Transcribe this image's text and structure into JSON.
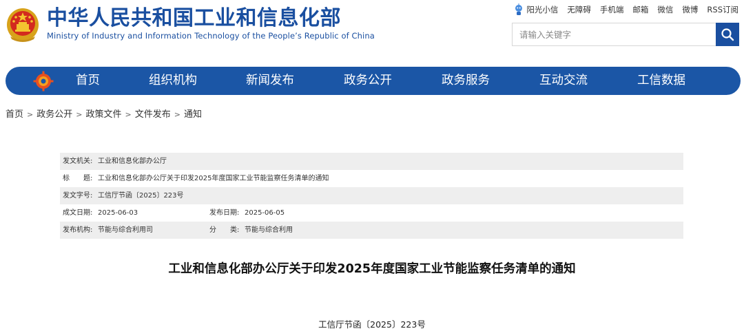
{
  "header": {
    "title": "中华人民共和国工业和信息化部",
    "subtitle": "Ministry of Industry and Information Technology of the People’s Republic of China",
    "links": [
      "阳光小信",
      "无障碍",
      "手机端",
      "邮箱",
      "微信",
      "微博",
      "RSS订阅"
    ],
    "search_placeholder": "请输入关键字",
    "brand_color": "#1a4fa0"
  },
  "nav": {
    "items": [
      "首页",
      "组织机构",
      "新闻发布",
      "政务公开",
      "政务服务",
      "互动交流",
      "工信数据"
    ],
    "bg_color": "#1b56a6"
  },
  "breadcrumb": [
    "首页",
    "政务公开",
    "政策文件",
    "文件发布",
    "通知"
  ],
  "info": {
    "issuer_label": "发文机关:",
    "issuer": "工业和信息化部办公厅",
    "title_label": "标　　题:",
    "title": "工业和信息化部办公厅关于印发2025年度国家工业节能监察任务清单的通知",
    "docno_label": "发文字号:",
    "docno": "工信厅节函〔2025〕223号",
    "written_label": "成文日期:",
    "written": "2025-06-03",
    "published_label": "发布日期:",
    "published": "2025-06-05",
    "org_label": "发布机构:",
    "org": "节能与综合利用司",
    "category_label": "分　　类:",
    "category": "节能与综合利用"
  },
  "document": {
    "title": "工业和信息化部办公厅关于印发2025年度国家工业节能监察任务清单的通知",
    "number": "工信厅节函〔2025〕223号"
  }
}
